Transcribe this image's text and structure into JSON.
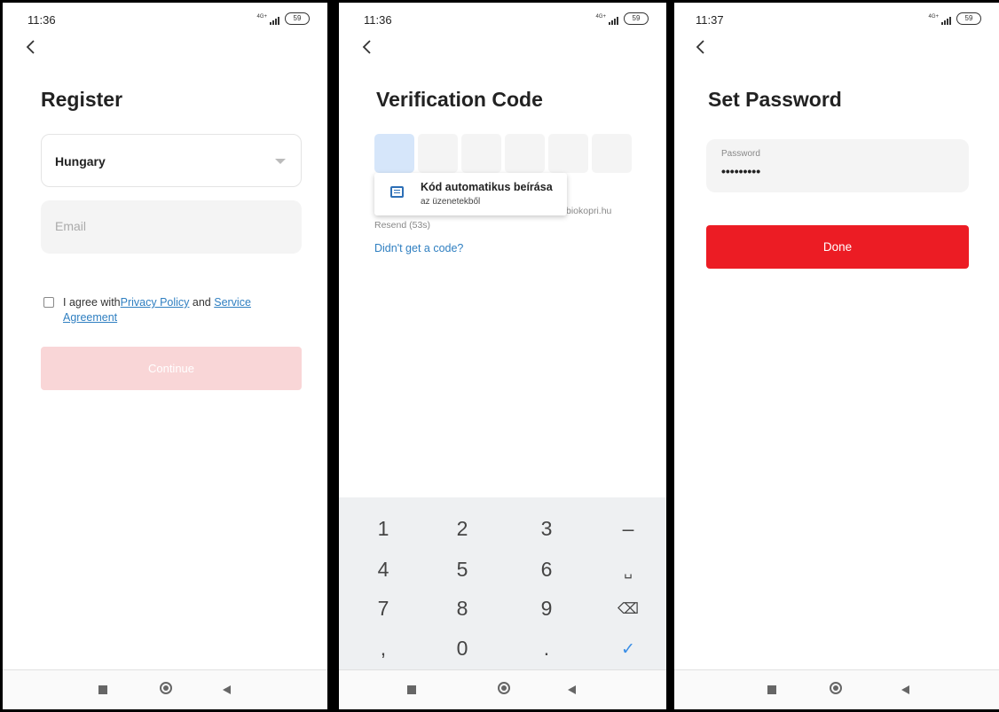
{
  "screens": [
    {
      "time": "11:36",
      "network": "4G+",
      "battery": "59",
      "title": "Register",
      "country": "Hungary",
      "email_placeholder": "Email",
      "agree_prefix": "I agree with",
      "privacy_policy": "Privacy Policy",
      "agree_and": " and ",
      "service_agreement": "Service Agreement",
      "continue_label": "Continue"
    },
    {
      "time": "11:36",
      "network": "4G+",
      "battery": "59",
      "title": "Verification Code",
      "code_digits": [
        "",
        "",
        "",
        "",
        "",
        ""
      ],
      "autofill_title": "Kód automatikus beírása",
      "autofill_subtitle": "az üzenetekből",
      "sent_email_fragment": "biokopri.hu",
      "resend": "Resend (53s)",
      "didnt_get_code": "Didn't get a code?",
      "keys": [
        "1",
        "2",
        "3",
        "–",
        "4",
        "5",
        "6",
        "␣",
        "7",
        "8",
        "9",
        "⌫",
        ",",
        "0",
        ".",
        "✓"
      ]
    },
    {
      "time": "11:37",
      "network": "4G+",
      "battery": "59",
      "title": "Set Password",
      "password_label": "Password",
      "password_value": "•••••••••",
      "done_label": "Done"
    }
  ],
  "colors": {
    "link": "#2f7fc1",
    "done_button": "#ec1c24",
    "continue_disabled": "#f9d6d7",
    "active_code_box": "#d6e6fa"
  }
}
